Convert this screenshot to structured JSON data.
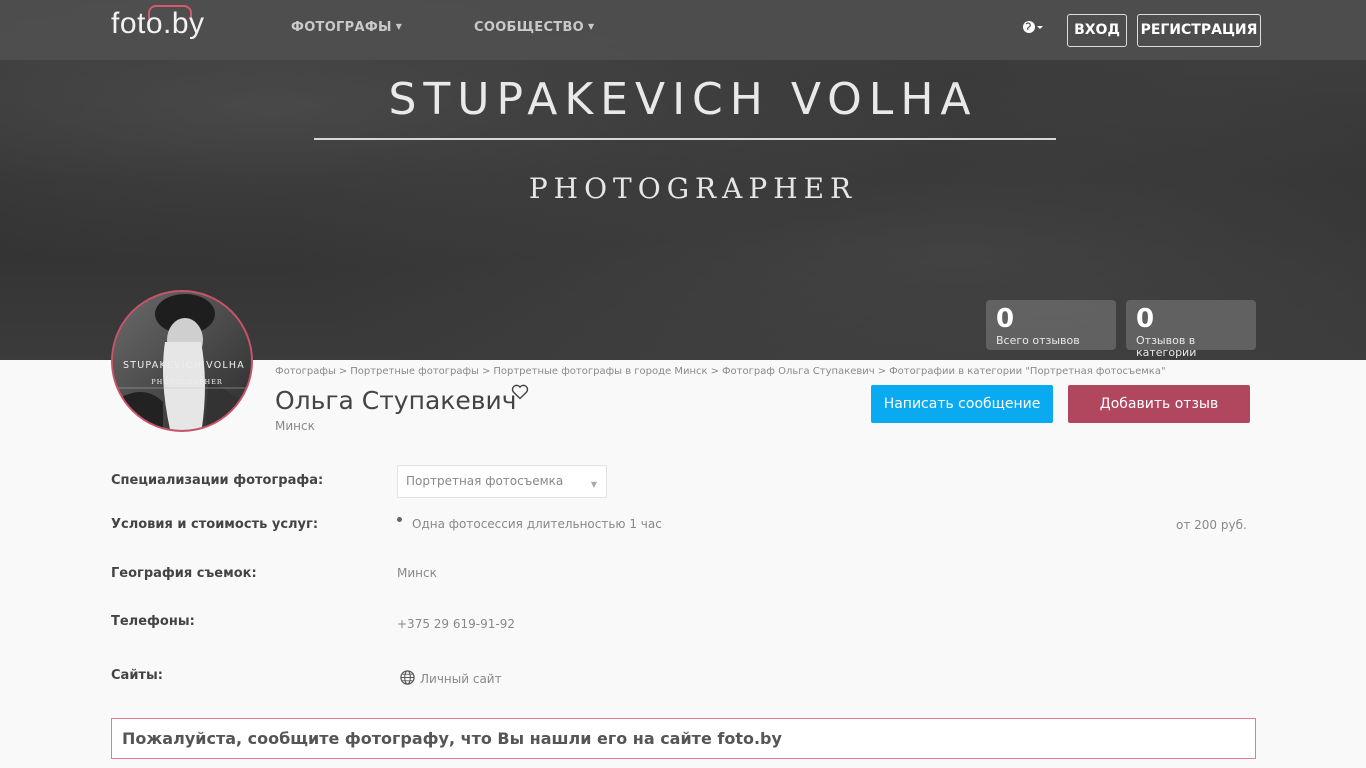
{
  "navbar": {
    "logo": "foto.by",
    "menu": [
      {
        "label": "ФОТОГРАФЫ"
      },
      {
        "label": "СООБЩЕСТВО"
      }
    ],
    "login": "ВХОД",
    "register": "РЕГИСТРАЦИЯ"
  },
  "cover": {
    "title": "STUPAKEVICH VOLHA",
    "subtitle": "PHOTOGRAPHER"
  },
  "stats": [
    {
      "value": "0",
      "label": "Всего отзывов"
    },
    {
      "value": "0",
      "label": "Отзывов в категории"
    }
  ],
  "avatar": {
    "text_line1": "STUPAKEVICH VOLHA",
    "text_line2": "PHOTOGRAPHER"
  },
  "breadcrumb": [
    "Фотографы",
    "Портретные фотографы",
    "Портретные фотографы в городе Минск",
    "Фотограф Ольга Ступакевич",
    "Фотографии в категории \"Портретная фотосъемка\""
  ],
  "profile": {
    "name": "Ольга Ступакевич",
    "city": "Минск",
    "message_button": "Написать сообщение",
    "review_button": "Добавить отзыв"
  },
  "info": {
    "specialization_label": "Специализации фотографа:",
    "specialization_value": "Портретная фотосъемка",
    "services_label": "Условия и стоимость услуг:",
    "service_item": "Одна фотосессия длительностью 1 час",
    "service_price": "от 200 руб.",
    "geo_label": "География съемок:",
    "geo_value": "Минск",
    "phones_label": "Телефоны:",
    "phone_value": "+375 29 619-91-92",
    "sites_label": "Сайты:",
    "site_value": "Личный сайт"
  },
  "notice": "Пожалуйста, сообщите фотографу, что Вы нашли его на сайте foto.by",
  "colors": {
    "accent_blue": "#0aaaf0",
    "accent_rose": "#b0475f",
    "logo_red": "#d45a6e"
  }
}
